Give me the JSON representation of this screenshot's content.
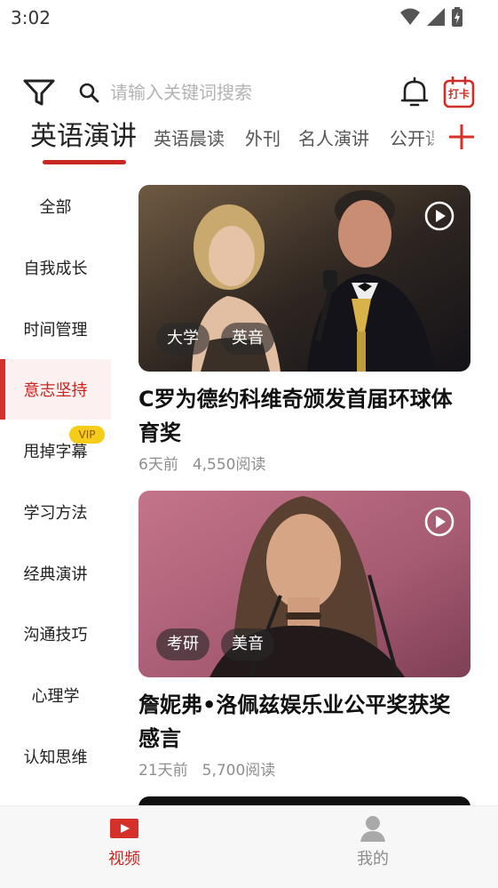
{
  "status_bar": {
    "time": "3:02"
  },
  "header": {
    "search_placeholder": "请输入关键词搜索",
    "checkin_label": "打卡",
    "accent_color": "#c8261f"
  },
  "tabs": [
    {
      "label": "英语演讲",
      "active": true
    },
    {
      "label": "英语晨读",
      "active": false
    },
    {
      "label": "外刊",
      "active": false
    },
    {
      "label": "名人演讲",
      "active": false
    },
    {
      "label": "公开课",
      "active": false
    }
  ],
  "sidebar": {
    "items": [
      {
        "label": "全部",
        "active": false
      },
      {
        "label": "自我成长",
        "active": false
      },
      {
        "label": "时间管理",
        "active": false
      },
      {
        "label": "意志坚持",
        "active": true
      },
      {
        "label": "甩掉字幕",
        "active": false
      },
      {
        "label": "学习方法",
        "active": false
      },
      {
        "label": "经典演讲",
        "active": false
      },
      {
        "label": "沟通技巧",
        "active": false
      },
      {
        "label": "心理学",
        "active": false
      },
      {
        "label": "认知思维",
        "active": false
      }
    ],
    "vip_badge": "VIP"
  },
  "feed": {
    "cards": [
      {
        "title": "C罗为德约科维奇颁发首届环球体育奖",
        "tags": [
          "大学",
          "英音"
        ],
        "time": "6天前",
        "reads": "4,550阅读"
      },
      {
        "title": "詹妮弗•洛佩兹娱乐业公平奖获奖感言",
        "tags": [
          "考研",
          "美音"
        ],
        "time": "21天前",
        "reads": "5,700阅读"
      }
    ]
  },
  "bottom_nav": {
    "items": [
      {
        "label": "视频",
        "icon": "video-icon",
        "active": true
      },
      {
        "label": "我的",
        "icon": "person-icon",
        "active": false
      }
    ]
  }
}
